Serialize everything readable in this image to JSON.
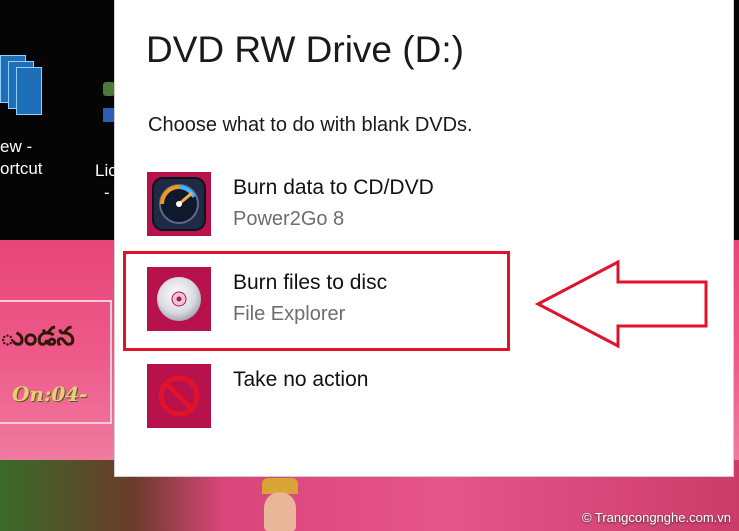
{
  "desktop": {
    "icon1_label_line1": "ew -",
    "icon1_label_line2": "ortcut",
    "icon2_label_line1": "Lic",
    "icon2_label_line2": "-",
    "background_text": "ుండన",
    "background_date": "On:04-",
    "watermark": "© Trangcongnghe.com.vn"
  },
  "dialog": {
    "title": "DVD RW Drive (D:)",
    "prompt": "Choose what to do with blank DVDs.",
    "options": [
      {
        "label": "Burn data to CD/DVD",
        "sublabel": "Power2Go 8",
        "icon": "power2go-icon"
      },
      {
        "label": "Burn files to disc",
        "sublabel": "File Explorer",
        "icon": "disc-icon"
      },
      {
        "label": "Take no action",
        "sublabel": "",
        "icon": "no-action-icon"
      }
    ]
  },
  "colors": {
    "tile": "#b8124c",
    "highlight": "#e0132b",
    "desktop_pink": "#e8457a"
  }
}
